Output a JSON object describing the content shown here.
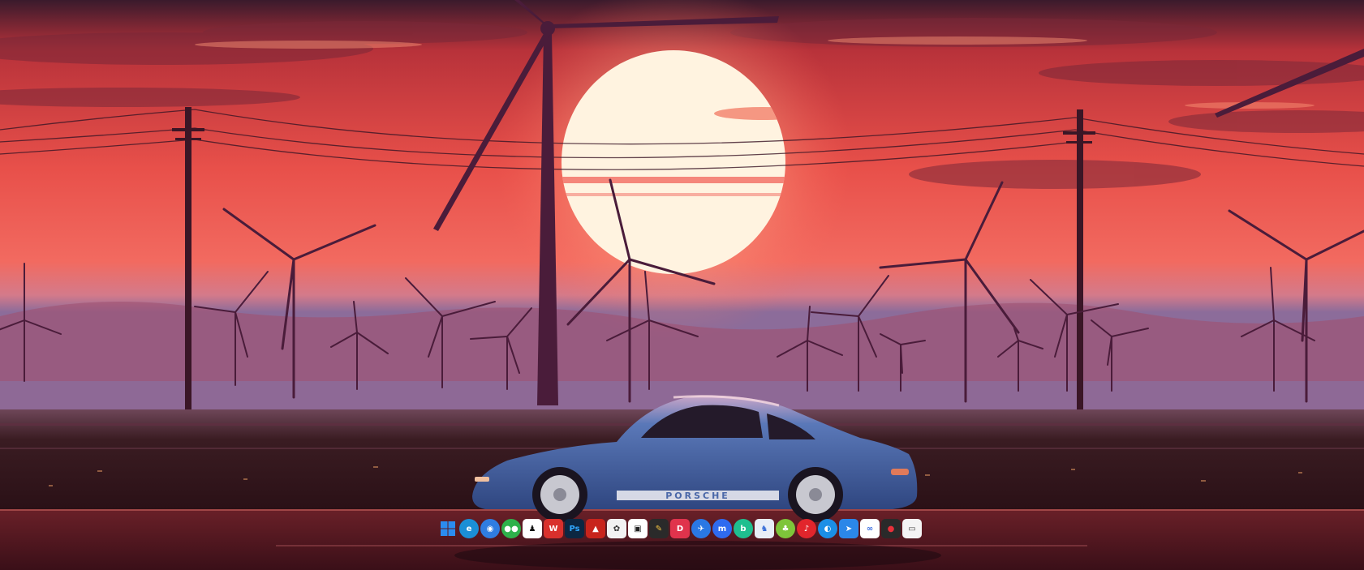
{
  "wallpaper": {
    "car_text": "PORSCHE",
    "colors": {
      "sky_top": "#3a1a2c",
      "sky_mid": "#e8504a",
      "sky_low": "#f08072",
      "horizon": "#8c6c9a",
      "ground": "#3a1c22",
      "road": "#5a1e26",
      "sun": "#fff3e0",
      "silhouette": "#4a1c3a",
      "car_body": "#4a67a8"
    }
  },
  "taskbar": {
    "icons": [
      {
        "name": "windows-start-icon",
        "glyph": "",
        "bg": "#1e6fd9",
        "fg": "#ffffff",
        "round": false
      },
      {
        "name": "edge-browser-icon",
        "glyph": "e",
        "bg": "#1b8fd6",
        "fg": "#ffffff",
        "round": true
      },
      {
        "name": "browser-icon",
        "glyph": "◉",
        "bg": "#2f7de1",
        "fg": "#ffffff",
        "round": true
      },
      {
        "name": "wechat-icon",
        "glyph": "●●",
        "bg": "#2fb24b",
        "fg": "#ffffff",
        "round": true
      },
      {
        "name": "qq-icon",
        "glyph": "♟",
        "bg": "#ffffff",
        "fg": "#111111",
        "round": false
      },
      {
        "name": "wps-office-icon",
        "glyph": "W",
        "bg": "#d9302c",
        "fg": "#ffffff",
        "round": false
      },
      {
        "name": "photoshop-icon",
        "glyph": "Ps",
        "bg": "#0c2742",
        "fg": "#31a8ff",
        "round": false
      },
      {
        "name": "acrobat-icon",
        "glyph": "▲",
        "bg": "#c8241c",
        "fg": "#ffffff",
        "round": false
      },
      {
        "name": "app-icon-1",
        "glyph": "✿",
        "bg": "#f2f2f2",
        "fg": "#333333",
        "round": false
      },
      {
        "name": "app-icon-2",
        "glyph": "▣",
        "bg": "#ffffff",
        "fg": "#222222",
        "round": false
      },
      {
        "name": "app-icon-3",
        "glyph": "✎",
        "bg": "#2a2a2a",
        "fg": "#f5c542",
        "round": false
      },
      {
        "name": "app-icon-4",
        "glyph": "D",
        "bg": "#e0334c",
        "fg": "#ffffff",
        "round": false
      },
      {
        "name": "app-icon-5",
        "glyph": "✈",
        "bg": "#2a78e4",
        "fg": "#ffffff",
        "round": true
      },
      {
        "name": "app-icon-6",
        "glyph": "m",
        "bg": "#2f6bf0",
        "fg": "#ffffff",
        "round": true
      },
      {
        "name": "app-icon-7",
        "glyph": "b",
        "bg": "#1fbf8f",
        "fg": "#ffffff",
        "round": true
      },
      {
        "name": "app-icon-8",
        "glyph": "♞",
        "bg": "#e8eef8",
        "fg": "#3a6fd8",
        "round": false
      },
      {
        "name": "app-icon-9",
        "glyph": "♣",
        "bg": "#7ec53a",
        "fg": "#ffffff",
        "round": true
      },
      {
        "name": "netease-music-icon",
        "glyph": "♪",
        "bg": "#e2252c",
        "fg": "#ffffff",
        "round": true
      },
      {
        "name": "app-icon-10",
        "glyph": "◐",
        "bg": "#1b8fe6",
        "fg": "#ffffff",
        "round": true
      },
      {
        "name": "app-icon-11",
        "glyph": "➤",
        "bg": "#2b87e8",
        "fg": "#ffffff",
        "round": false
      },
      {
        "name": "app-icon-12",
        "glyph": "∞",
        "bg": "#ffffff",
        "fg": "#3a6fe0",
        "round": false
      },
      {
        "name": "record-icon",
        "glyph": "●",
        "bg": "#2a2a2a",
        "fg": "#e8303a",
        "round": false
      },
      {
        "name": "app-icon-13",
        "glyph": "▭",
        "bg": "#f4f4f4",
        "fg": "#444444",
        "round": false
      }
    ]
  }
}
